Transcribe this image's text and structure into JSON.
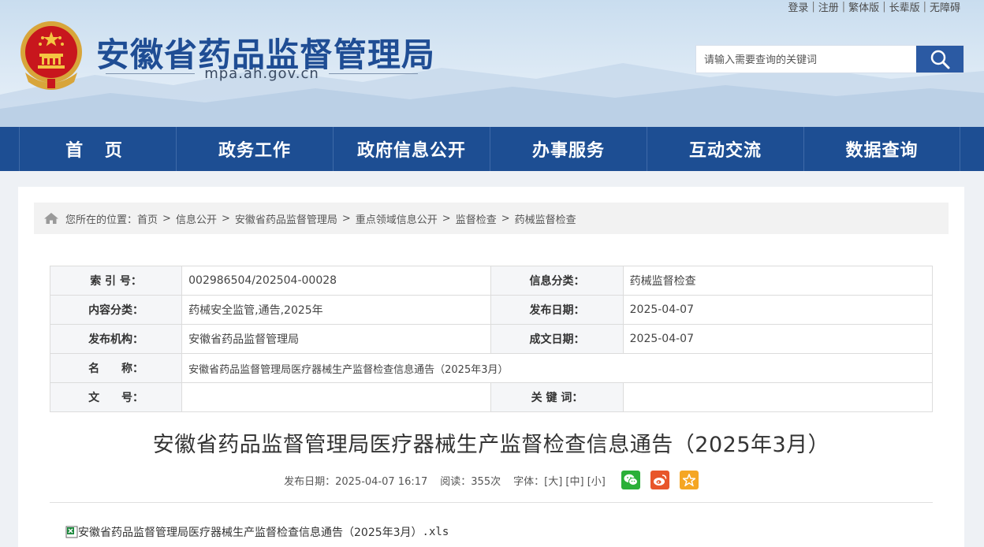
{
  "top_links": [
    "登录",
    "注册",
    "繁体版",
    "长辈版",
    "无障碍"
  ],
  "site": {
    "title": "安徽省药品监督管理局",
    "domain": "mpa.ah.gov.cn"
  },
  "search": {
    "placeholder": "请输入需要查询的关键词"
  },
  "nav": [
    "首 页",
    "政务工作",
    "政府信息公开",
    "办事服务",
    "互动交流",
    "数据查询"
  ],
  "breadcrumb": {
    "prefix": "您所在的位置：",
    "items": [
      "首页",
      "信息公开",
      "安徽省药品监督管理局",
      "重点领域信息公开",
      "监督检查",
      "药械监督检查"
    ]
  },
  "meta": {
    "index_label": "索 引 号：",
    "index_value": "002986504/202504-00028",
    "category_label": "信息分类：",
    "category_value": "药械监督检查",
    "content_label": "内容分类：",
    "content_value": "药械安全监管,通告,2025年",
    "pubdate_label": "发布日期：",
    "pubdate_value": "2025-04-07",
    "org_label": "发布机构：",
    "org_value": "安徽省药品监督管理局",
    "made_label": "成文日期：",
    "made_value": "2025-04-07",
    "name_label": "名　　称：",
    "name_value": "安徽省药品监督管理局医疗器械生产监督检查信息通告（2025年3月）",
    "docno_label": "文　　号：",
    "docno_value": "",
    "keywords_label": "关 键 词：",
    "keywords_value": ""
  },
  "article": {
    "title": "安徽省药品监督管理局医疗器械生产监督检查信息通告（2025年3月）",
    "publish": "发布日期：2025-04-07 16:17",
    "reads": "阅读：355次",
    "font_label": "字体：",
    "font_large": "[大]",
    "font_medium": "[中]",
    "font_small": "[小]",
    "attachment_name": "安徽省药品监督管理局医疗器械生产监督检查信息通告（2025年3月）",
    "attachment_ext": ".xls"
  },
  "colors": {
    "brand": "#1d4e93",
    "title": "#1f4d94",
    "wechat": "#2ab038",
    "weibo": "#e8562a",
    "favorite": "#f5a623"
  },
  "icons": [
    "emblem",
    "search-icon",
    "home-icon",
    "wechat-icon",
    "weibo-icon",
    "star-icon",
    "excel-icon"
  ]
}
